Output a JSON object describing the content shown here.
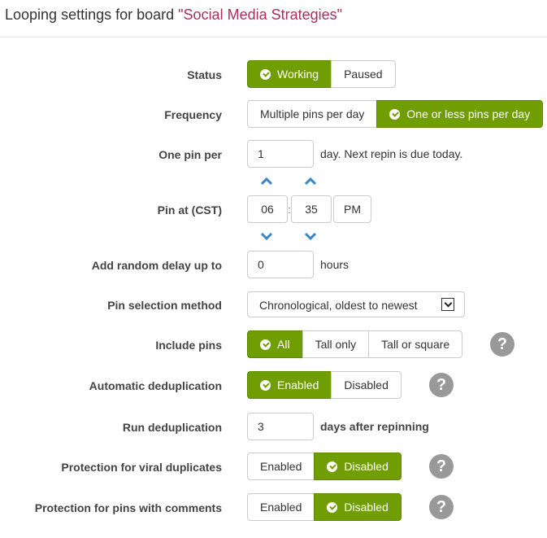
{
  "header": {
    "title_prefix": "Looping settings for board ",
    "board_name": "\"Social Media Strategies\""
  },
  "colors": {
    "accent_green": "#6f9d02",
    "board_name": "#a3325c",
    "help_icon": "#999999",
    "chevron_blue": "#3a87c8"
  },
  "status": {
    "label": "Status",
    "options": [
      "Working",
      "Paused"
    ],
    "selected": "Working"
  },
  "frequency": {
    "label": "Frequency",
    "options": [
      "Multiple pins per day",
      "One or less pins per day"
    ],
    "selected": "One or less pins per day"
  },
  "one_pin_per": {
    "label": "One pin per",
    "value": "1",
    "suffix": "day. Next repin is due today."
  },
  "pin_at": {
    "label": "Pin at (CST)",
    "hour": "06",
    "separator": ":",
    "minute": "35",
    "ampm": "PM"
  },
  "random_delay": {
    "label": "Add random delay up to",
    "value": "0",
    "suffix": "hours"
  },
  "pin_selection": {
    "label": "Pin selection method",
    "selected": "Chronological, oldest to newest"
  },
  "include_pins": {
    "label": "Include pins",
    "options": [
      "All",
      "Tall only",
      "Tall or square"
    ],
    "selected": "All",
    "help": "?"
  },
  "auto_dedup": {
    "label": "Automatic deduplication",
    "options": [
      "Enabled",
      "Disabled"
    ],
    "selected": "Enabled",
    "help": "?"
  },
  "run_dedup": {
    "label": "Run deduplication",
    "value": "3",
    "suffix": "days after repinning"
  },
  "viral_protection": {
    "label": "Protection for viral duplicates",
    "options": [
      "Enabled",
      "Disabled"
    ],
    "selected": "Disabled",
    "help": "?"
  },
  "comments_protection": {
    "label": "Protection for pins with comments",
    "options": [
      "Enabled",
      "Disabled"
    ],
    "selected": "Disabled",
    "help": "?"
  }
}
